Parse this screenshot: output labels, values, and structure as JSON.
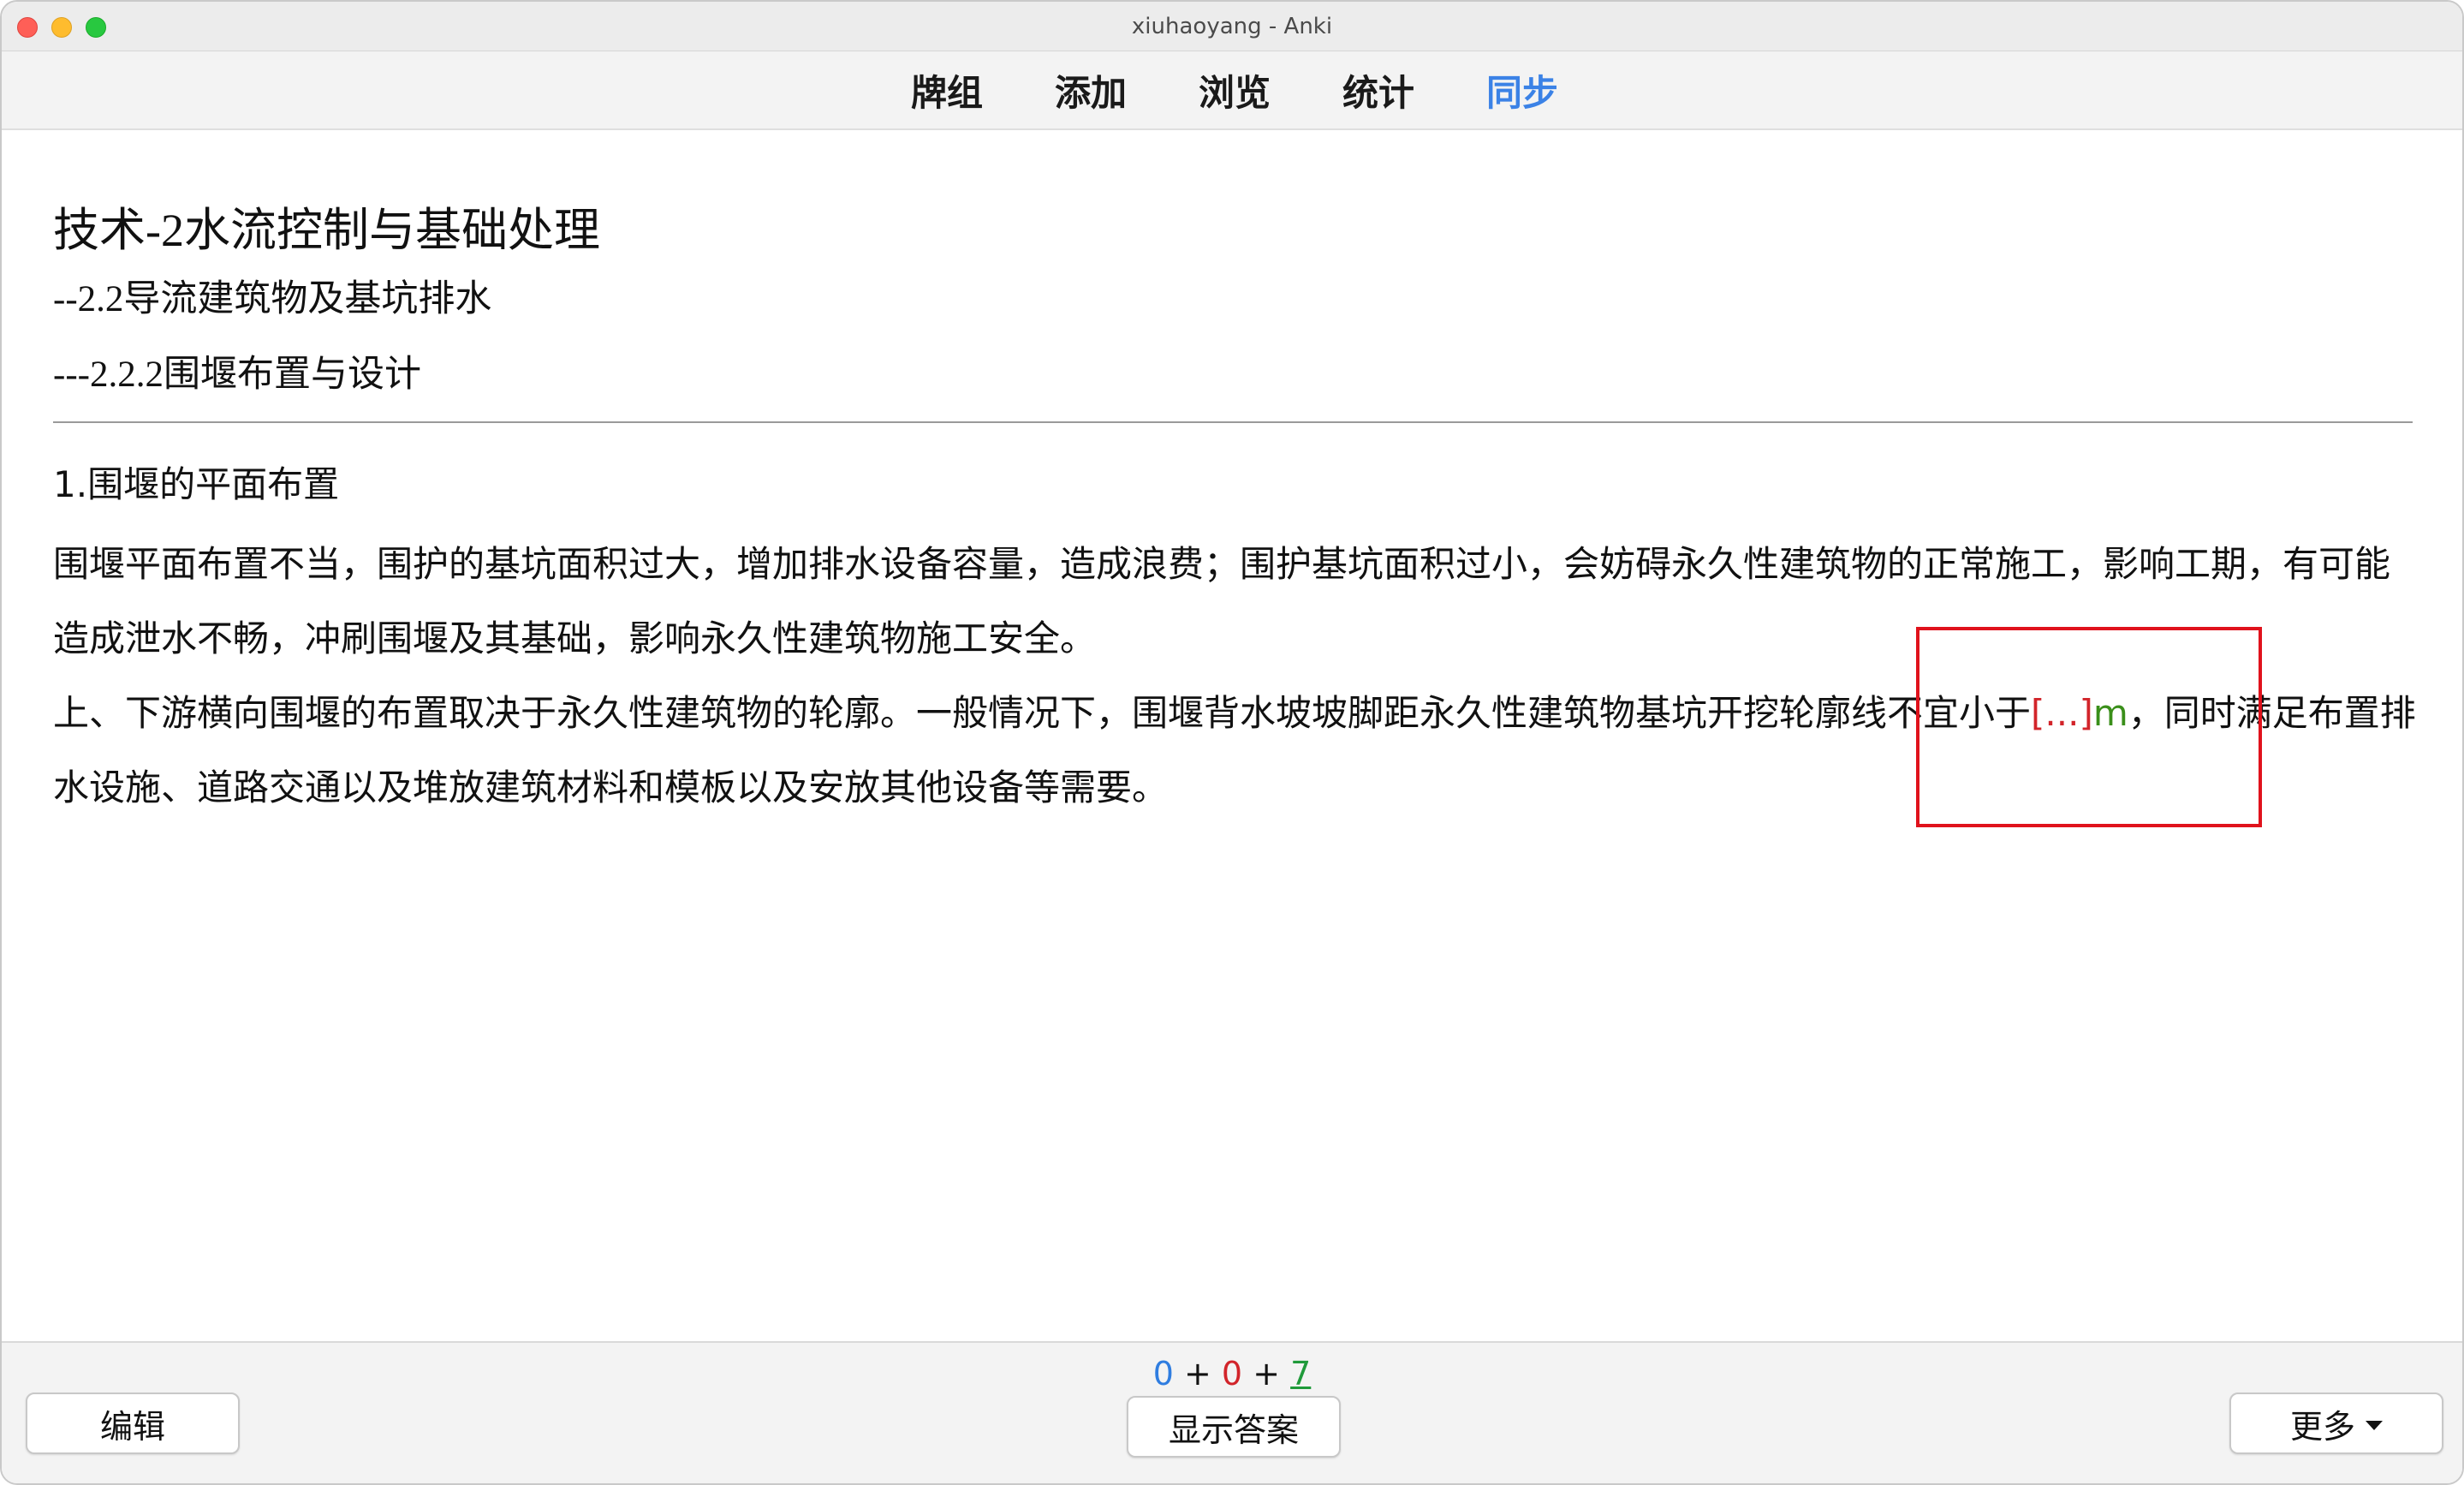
{
  "window": {
    "title": "xiuhaoyang - Anki"
  },
  "toolbar": {
    "tabs": [
      {
        "label": "牌组"
      },
      {
        "label": "添加"
      },
      {
        "label": "浏览"
      },
      {
        "label": "统计"
      },
      {
        "label": "同步"
      }
    ]
  },
  "card": {
    "deck_title": "技术-2水流控制与基础处理",
    "sub1": "--2.2导流建筑物及基坑排水",
    "sub2": "---2.2.2围堰布置与设计",
    "section_head": "1.围堰的平面布置",
    "para1": "围堰平面布置不当，围护的基坑面积过大，增加排水设备容量，造成浪费；围护基坑面积过小，会妨碍永久性建筑物的正常施工，影响工期，有可能造成泄水不畅，冲刷围堰及其基础，影响永久性建筑物施工安全。",
    "para2_before": "上、下游横向围堰的布置取决于永久性建筑物的轮廓。一般情况下，围堰背水坡坡脚距永久性建筑物基坑开挖轮廓线不宜小于",
    "cloze": "[...]",
    "unit": "m",
    "para2_after": "，同时满足布置排水设施、道路交通以及堆放建筑材料和模板以及安放其他设备等需要。"
  },
  "counts": {
    "new": "0",
    "plus1": "+",
    "learning": "0",
    "plus2": "+",
    "review": "7"
  },
  "buttons": {
    "edit": "编辑",
    "show_answer": "显示答案",
    "more": "更多"
  },
  "colors": {
    "sync_tab": "#3b82e6",
    "cloze": "#d2242a",
    "highlight_box": "#e0121c",
    "new_count": "#2f7de0",
    "review_count": "#1f9a3a"
  }
}
